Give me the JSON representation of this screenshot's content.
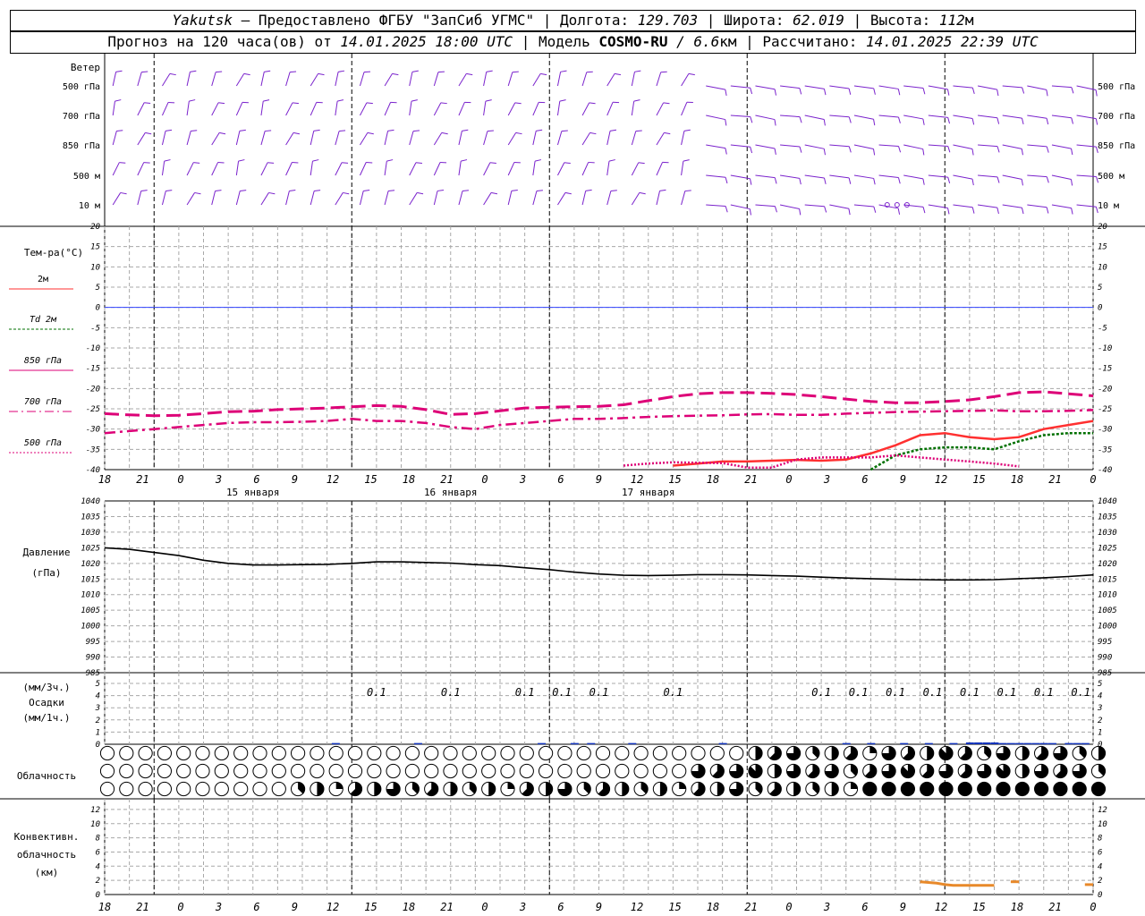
{
  "header": {
    "station": "Yakutsk",
    "provider_text": " – Предоставлено ФГБУ \"ЗапСиб УГМС\" | Долгота: ",
    "longitude": "129.703",
    "lat_label": " | Широта: ",
    "latitude": "62.019",
    "alt_label": " | Высота: ",
    "altitude": "112",
    "alt_unit": "м",
    "forecast_prefix": "Прогноз на 120 часа(ов) от ",
    "forecast_start": "14.01.2025 18:00 UTC",
    "model_label": " | Модель ",
    "model_name": "COSMO-RU",
    "model_res": " / 6.6",
    "model_res_unit": "км",
    "calc_label": " | Рассчитано: ",
    "calc_time": "14.01.2025 22:39 UTC"
  },
  "wind_panel": {
    "title": "Ветер",
    "levels": [
      "500 гПа",
      "700 гПа",
      "850 гПа",
      "500 м",
      "10 м"
    ]
  },
  "temp_panel": {
    "title": "Тем-ра(°C)",
    "legend": [
      {
        "label": "2м",
        "color": "#ff3030",
        "dash": "solid"
      },
      {
        "label": "Td  2м",
        "color": "#007000",
        "dash": "dash"
      },
      {
        "label": "850 гПа",
        "color": "#dd0077",
        "dash": "solid"
      },
      {
        "label": "700 гПа",
        "color": "#dd0077",
        "dash": "dashdot"
      },
      {
        "label": "500 гПа",
        "color": "#dd0077",
        "dash": "dot"
      }
    ],
    "yticks": [
      "20",
      "15",
      "10",
      "5",
      "0",
      "-5",
      "-10",
      "-15",
      "-20",
      "-25",
      "-30",
      "-35",
      "-40"
    ]
  },
  "time_axis": {
    "hour_labels": [
      "18",
      "21",
      "0",
      "3",
      "6",
      "9",
      "12",
      "15",
      "18",
      "21",
      "0",
      "3",
      "6",
      "9",
      "12",
      "15",
      "18",
      "21",
      "0",
      "3",
      "6",
      "9",
      "12",
      "15",
      "18",
      "21",
      "0"
    ],
    "day_labels": [
      "15 января",
      "16 января",
      "17 января"
    ]
  },
  "pressure_panel": {
    "title": "Давление",
    "unit": "(гПа)",
    "yticks": [
      "1040",
      "1035",
      "1030",
      "1025",
      "1020",
      "1015",
      "1010",
      "1005",
      "1000",
      "995",
      "990",
      "985"
    ]
  },
  "precip_panel": {
    "title_1": "(мм/3ч.)",
    "title_2": "Осадки",
    "title_3": "(мм/1ч.)",
    "yticks": [
      "5",
      "4",
      "3",
      "2",
      "1",
      "0"
    ],
    "labels": [
      "0.1",
      "0.1",
      "0.1",
      "0.1",
      "0.1",
      "0.1",
      "0.1",
      "0.1",
      "0.1",
      "0.1",
      "0.1",
      "0.1",
      "0.1",
      "0.1",
      "0.1"
    ]
  },
  "cloud_panel": {
    "title": "Облачность"
  },
  "conv_panel": {
    "title_1": "Конвективн.",
    "title_2": "облачность",
    "title_3": "(км)",
    "yticks": [
      "12",
      "10",
      "8",
      "6",
      "4",
      "2",
      "0"
    ]
  },
  "colors": {
    "wind": "#7a22cc",
    "grid": "#a8a8a8",
    "zero_line": "#3344ff",
    "t2m": "#ff3030",
    "td2m": "#007000",
    "level_temps": "#dd0077",
    "pressure": "#000000",
    "precip": "#1133bb",
    "convective": "#e8892a"
  },
  "chart_data": [
    {
      "type": "line",
      "name": "Тем-ра(°C)",
      "x_hours": [
        0,
        3,
        6,
        9,
        12,
        15,
        18,
        21,
        24,
        27,
        30,
        33,
        36,
        39,
        42,
        45,
        48,
        51,
        54,
        57,
        60,
        63,
        66,
        69,
        72,
        75,
        78,
        81,
        84,
        87,
        90,
        93,
        96,
        99,
        102,
        105,
        108,
        111,
        114,
        117,
        120
      ],
      "ylim": [
        -40,
        20
      ],
      "series": [
        {
          "name": "2м",
          "values": [
            null,
            null,
            null,
            null,
            null,
            null,
            null,
            null,
            null,
            null,
            null,
            null,
            null,
            null,
            null,
            null,
            null,
            null,
            null,
            null,
            null,
            null,
            null,
            -39,
            -38.5,
            -38,
            -38,
            -37.8,
            -37.6,
            -37.8,
            -37.5,
            -36,
            -34,
            -31.5,
            -31,
            -32,
            -32.5,
            -32,
            -30,
            -29,
            -28
          ]
        },
        {
          "name": "Td  2м",
          "values": [
            null,
            null,
            null,
            null,
            null,
            null,
            null,
            null,
            null,
            null,
            null,
            null,
            null,
            null,
            null,
            null,
            null,
            null,
            null,
            null,
            null,
            null,
            null,
            null,
            null,
            null,
            null,
            null,
            null,
            null,
            null,
            -40,
            -36.5,
            -35,
            -34.5,
            -34.5,
            -35,
            -33,
            -31.5,
            -31,
            -31
          ]
        },
        {
          "name": "850 гПа",
          "values": [
            null,
            null,
            null,
            null,
            null,
            null,
            null,
            null,
            null,
            null,
            null,
            null,
            null,
            null,
            null,
            null,
            null,
            null,
            null,
            null,
            null,
            -39,
            -38.5,
            -38.2,
            -38.3,
            -38.4,
            -39.5,
            -39.5,
            -37.5,
            -37,
            -37,
            -37,
            -36.5,
            -37,
            -37.5,
            -38,
            -38.5,
            -39.2,
            null,
            null,
            null
          ]
        },
        {
          "name": "700 гПа",
          "values": [
            -31,
            -30.5,
            -30,
            -29.5,
            -29,
            -28.5,
            -28.3,
            -28.3,
            -28.2,
            -28,
            -27.5,
            -28,
            -28,
            -28.5,
            -29.5,
            -30,
            -29,
            -28.5,
            -28,
            -27.5,
            -27.5,
            -27.3,
            -27,
            -26.8,
            -26.7,
            -26.6,
            -26.4,
            -26.3,
            -26.5,
            -26.5,
            -26.2,
            -26,
            -25.8,
            -25.7,
            -25.6,
            -25.5,
            -25.4,
            -25.6,
            -25.6,
            -25.5,
            -25.3
          ]
        },
        {
          "name": "500 гПа",
          "values": [
            -26.2,
            -26.5,
            -26.7,
            -26.6,
            -26.2,
            -25.7,
            -25.6,
            -25.2,
            -25,
            -24.8,
            -24.5,
            -24.2,
            -24.4,
            -25.2,
            -26.4,
            -26.2,
            -25.5,
            -24.8,
            -24.6,
            -24.5,
            -24.4,
            -24,
            -23,
            -22,
            -21.3,
            -21,
            -21,
            -21.2,
            -21.5,
            -22,
            -22.6,
            -23.2,
            -23.5,
            -23.5,
            -23.2,
            -22.8,
            -22,
            -21,
            -20.8,
            -21.3,
            -21.8
          ]
        }
      ]
    },
    {
      "type": "line",
      "name": "Давление",
      "x_hours": [
        0,
        3,
        6,
        9,
        12,
        15,
        18,
        21,
        24,
        27,
        30,
        33,
        36,
        39,
        42,
        45,
        48,
        51,
        54,
        57,
        60,
        63,
        66,
        69,
        72,
        75,
        78,
        81,
        84,
        87,
        90,
        93,
        96,
        99,
        102,
        105,
        108,
        111,
        114,
        117,
        120
      ],
      "ylim": [
        985,
        1040
      ],
      "series": [
        {
          "name": "pressure",
          "values": [
            1025,
            1024.5,
            1023.5,
            1022.5,
            1021,
            1020,
            1019.5,
            1019.5,
            1019.6,
            1019.7,
            1020,
            1020.5,
            1020.5,
            1020.3,
            1020.1,
            1019.6,
            1019.3,
            1018.6,
            1018,
            1017.2,
            1016.6,
            1016.2,
            1016.1,
            1016.2,
            1016.4,
            1016.4,
            1016.3,
            1016.1,
            1015.9,
            1015.6,
            1015.3,
            1015.1,
            1014.9,
            1014.8,
            1014.7,
            1014.7,
            1014.8,
            1015.1,
            1015.4,
            1015.8,
            1016.3
          ]
        }
      ]
    },
    {
      "type": "bar",
      "name": "Осадки",
      "x_hours": [
        28,
        38,
        53,
        57,
        59,
        64,
        75,
        90,
        93,
        97,
        100,
        103,
        105,
        106,
        107,
        108,
        109,
        110,
        111,
        112,
        113,
        114,
        115,
        117,
        118,
        119
      ],
      "ylim": [
        0,
        5
      ],
      "values": [
        0.1,
        0.1,
        0.1,
        0.1,
        0.1,
        0.1,
        0.1,
        0.1,
        0.1,
        0.1,
        0.1,
        0.1,
        0.15,
        0.15,
        0.15,
        0.15,
        0.1,
        0.1,
        0.1,
        0.1,
        0.1,
        0.1,
        0.1,
        0.1,
        0.1,
        0.1
      ]
    },
    {
      "type": "line",
      "name": "Конвективн. облачность",
      "ylim": [
        0,
        13
      ],
      "segments": [
        {
          "x_hours": [
            99,
            100,
            101,
            102,
            103,
            104,
            105,
            106,
            107,
            108
          ],
          "values": [
            1.8,
            1.7,
            1.6,
            1.4,
            1.3,
            1.3,
            1.3,
            1.3,
            1.3,
            1.3
          ]
        },
        {
          "x_hours": [
            110,
            111
          ],
          "values": [
            1.8,
            1.8
          ]
        },
        {
          "x_hours": [
            119,
            120
          ],
          "values": [
            1.4,
            1.4
          ]
        }
      ]
    }
  ]
}
